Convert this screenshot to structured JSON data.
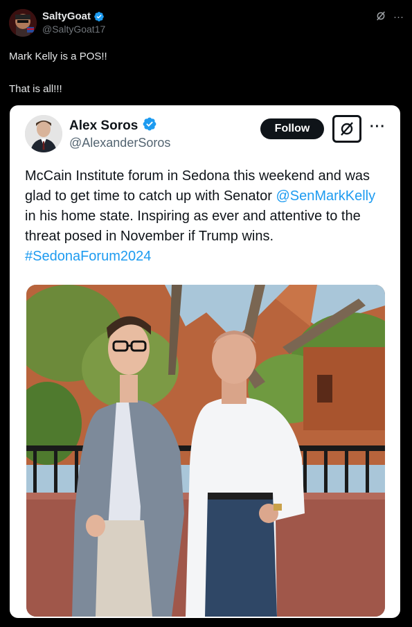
{
  "post": {
    "author_name": "SaltyGoat",
    "author_handle": "@SaltyGoat17",
    "line1": "Mark Kelly is a POS!!",
    "line2": "That is all!!!"
  },
  "quoted": {
    "author_name": "Alex Soros",
    "author_handle": "@AlexanderSoros",
    "follow_label": "Follow",
    "text_part1": "McCain Institute forum in Sedona this weekend and was glad to get time to catch up with Senator ",
    "mention": "@SenMarkKelly",
    "text_part2": " in his home state. Inspiring as ever and attentive to the threat posed in November if Trump wins. ",
    "hashtag": "#SedonaForum2024"
  },
  "icons": {
    "verified": "verified-badge-icon",
    "grok": "grok-icon",
    "more": "more-icon"
  },
  "colors": {
    "verified": "#1d9bf0",
    "link": "#1d9bf0",
    "background": "#000000"
  }
}
